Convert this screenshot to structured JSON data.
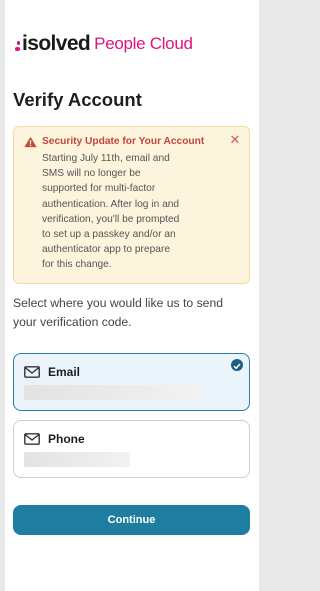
{
  "brand": {
    "name": "isolved",
    "product": "People Cloud",
    "accent_color": "#e0137e"
  },
  "page": {
    "title": "Verify Account"
  },
  "alert": {
    "icon": "warning-icon",
    "title": "Security Update for Your Account",
    "body_lines": [
      "Starting July 11th, email and",
      "SMS will no longer be",
      "supported for multi-factor",
      "authentication. After log in and",
      "verification, you'll be prompted",
      "to set up a passkey and/or an",
      "authenticator app to prepare",
      "for this change."
    ],
    "close_icon": "close-icon"
  },
  "prompt": {
    "lines": [
      "Select where you would like us to send",
      "your verification code."
    ]
  },
  "options": [
    {
      "label": "Email",
      "icon": "mail-icon",
      "selected": true,
      "value": "████████████████████████"
    },
    {
      "label": "Phone",
      "icon": "mail-icon",
      "selected": false,
      "value": "██████████████"
    }
  ],
  "actions": {
    "continue_label": "Continue",
    "button_color": "#1f7ea0"
  }
}
